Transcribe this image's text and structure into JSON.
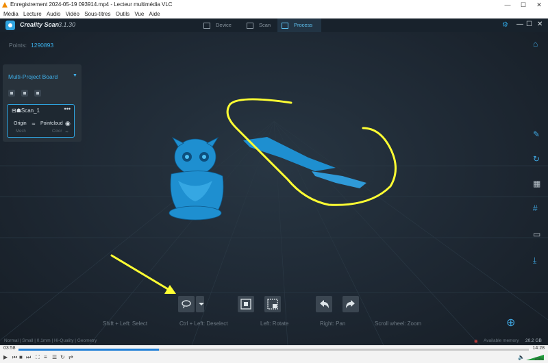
{
  "vlc": {
    "title": "Enregistrement 2024-05-19 093914.mp4 - Lecteur multimédia VLC",
    "menu": [
      "Média",
      "Lecture",
      "Audio",
      "Vidéo",
      "Sous-titres",
      "Outils",
      "Vue",
      "Aide"
    ],
    "window_controls": [
      "—",
      "☐",
      "✕"
    ],
    "time_elapsed": "03:58",
    "time_total": "14:28",
    "progress_fraction": 0.275,
    "volume": "100%"
  },
  "app": {
    "name": "Creality Scan",
    "version": "3.1.30",
    "tabs": [
      {
        "label": "Device",
        "icon": "device-icon",
        "active": false
      },
      {
        "label": "Scan",
        "icon": "scan-icon",
        "active": false
      },
      {
        "label": "Process",
        "icon": "process-icon",
        "active": true
      }
    ],
    "window_buttons": [
      "—",
      "☐",
      "✕"
    ]
  },
  "viewport": {
    "points_label": "Points:",
    "points_value": "1290893"
  },
  "panel": {
    "title": "Multi-Project Board",
    "scan_name": "Scan_1",
    "origin_label": "Origin",
    "pointcloud_label": "Pointcloud",
    "mesh_label": "Mesh",
    "color_label": "Color",
    "more": "•••"
  },
  "hints": {
    "select": "Shift + Left:  Select",
    "deselect": "Ctrl + Left:  Deselect",
    "rotate": "Left:  Rotate",
    "pan": "Right:  Pan",
    "zoom": "Scroll wheel:  Zoom"
  },
  "status": {
    "settings": "Normal | Small | 0.1mm | Hi-Quality | Geometry",
    "memory_label": "Available memory",
    "memory_value": "20.2 GB"
  },
  "colors": {
    "accent": "#2fa4e0",
    "model": "#1e8fd0",
    "annotation": "#ffff33",
    "background": "#1e2833"
  }
}
